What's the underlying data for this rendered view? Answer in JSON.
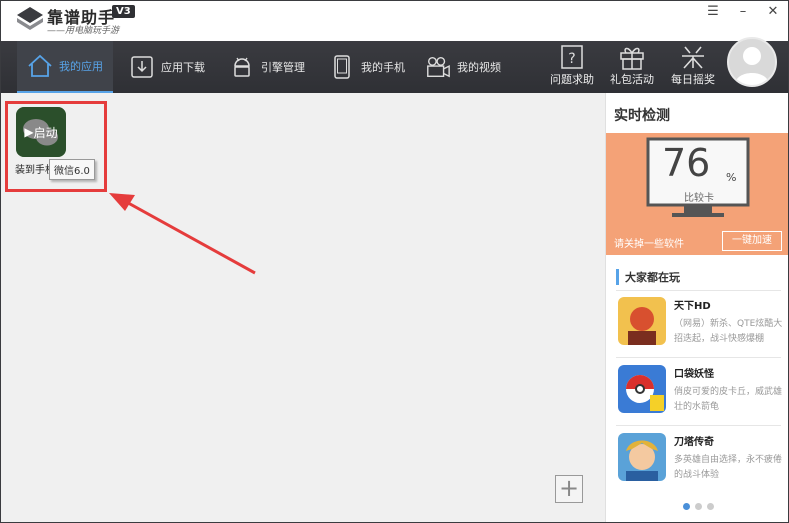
{
  "app": {
    "brand": "靠谱助手",
    "version": "V3",
    "slogan": "——用电脑玩手游"
  },
  "nav": {
    "tabs": [
      {
        "label": "我的应用",
        "icon": "home-icon",
        "active": true
      },
      {
        "label": "应用下载",
        "icon": "download-icon",
        "active": false
      },
      {
        "label": "引擎管理",
        "icon": "android-icon",
        "active": false
      },
      {
        "label": "我的手机",
        "icon": "phone-icon",
        "active": false
      },
      {
        "label": "我的视频",
        "icon": "video-icon",
        "active": false
      }
    ],
    "right_buttons": [
      {
        "label": "问题求助",
        "icon": "help-icon"
      },
      {
        "label": "礼包活动",
        "icon": "gift-icon"
      },
      {
        "label": "每日摇奖",
        "icon": "lottery-icon"
      }
    ]
  },
  "main": {
    "app_tile": {
      "overlay_label": "启动",
      "name": "装到手机",
      "tooltip": "微信6.0"
    }
  },
  "side": {
    "title": "实时检测",
    "score": "76",
    "score_unit": "%",
    "score_label": "比较卡",
    "clean_text": "请关掉一些软件",
    "boost_label": "一键加速",
    "section_title": "大家都在玩",
    "games": [
      {
        "name": "天下HD",
        "desc": "（网易）新杀、QTE炫酷大招迭起，战斗快感爆棚"
      },
      {
        "name": "口袋妖怪",
        "desc": "俏皮可爱的皮卡丘，威武雄壮的水箭龟"
      },
      {
        "name": "刀塔传奇",
        "desc": "多英雄自由选择，永不疲倦的战斗体验"
      }
    ]
  },
  "colors": {
    "accent": "#57a3e8",
    "nav_bg": "#2f3035",
    "monitor_bg": "#f4a277",
    "highlight": "#e53c3c"
  }
}
